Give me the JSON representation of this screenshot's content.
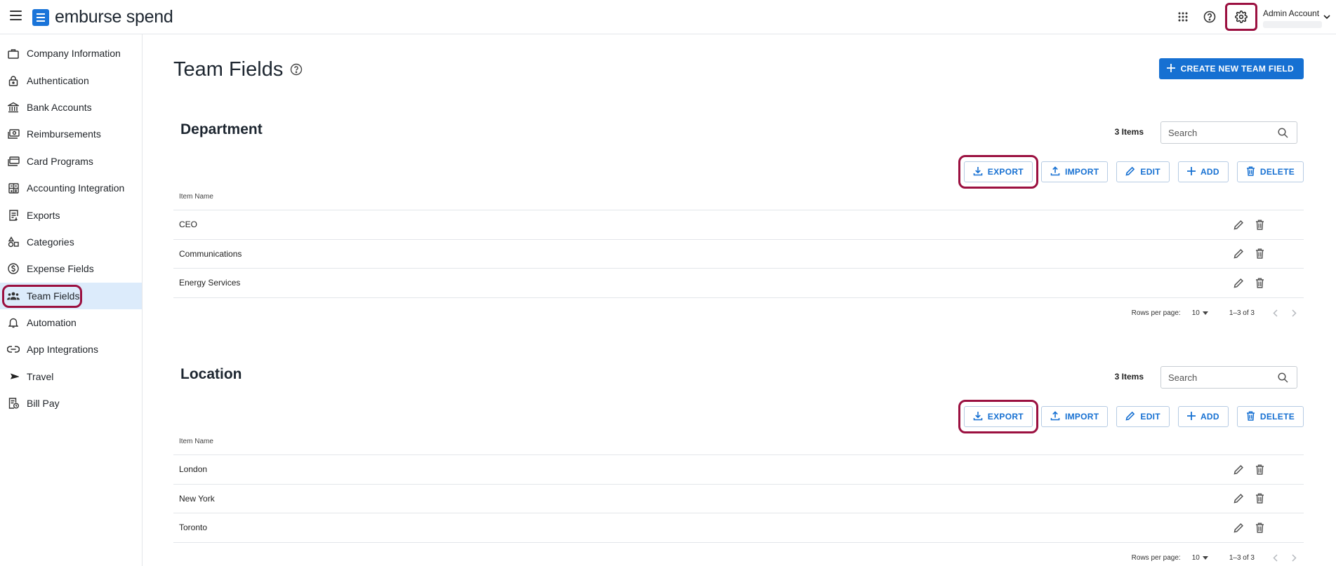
{
  "header": {
    "brand": "emburse spend",
    "account_name": "Admin Account"
  },
  "sidebar": {
    "items": [
      {
        "label": "Company Information",
        "icon": "briefcase-icon"
      },
      {
        "label": "Authentication",
        "icon": "lock-icon"
      },
      {
        "label": "Bank Accounts",
        "icon": "bank-icon"
      },
      {
        "label": "Reimbursements",
        "icon": "money-icon"
      },
      {
        "label": "Card Programs",
        "icon": "card-icon"
      },
      {
        "label": "Accounting Integration",
        "icon": "calculator-icon"
      },
      {
        "label": "Exports",
        "icon": "export-doc-icon"
      },
      {
        "label": "Categories",
        "icon": "shapes-icon"
      },
      {
        "label": "Expense Fields",
        "icon": "dollar-circle-icon"
      },
      {
        "label": "Team Fields",
        "icon": "team-icon",
        "active": true
      },
      {
        "label": "Automation",
        "icon": "bell-icon"
      },
      {
        "label": "App Integrations",
        "icon": "link-icon"
      },
      {
        "label": "Travel",
        "icon": "plane-icon"
      },
      {
        "label": "Bill Pay",
        "icon": "bill-icon"
      }
    ]
  },
  "main": {
    "title": "Team Fields",
    "create_button": "CREATE NEW TEAM FIELD",
    "sections": [
      {
        "title": "Department",
        "items_count": "3 Items",
        "search_placeholder": "Search",
        "actions": {
          "export": "EXPORT",
          "import": "IMPORT",
          "edit": "EDIT",
          "add": "ADD",
          "delete": "DELETE"
        },
        "column_header": "Item Name",
        "rows": [
          "CEO",
          "Communications",
          "Energy Services"
        ],
        "rows_per_page_label": "Rows per page:",
        "rows_per_page": "10",
        "range": "1–3 of 3"
      },
      {
        "title": "Location",
        "items_count": "3 Items",
        "search_placeholder": "Search",
        "actions": {
          "export": "EXPORT",
          "import": "IMPORT",
          "edit": "EDIT",
          "add": "ADD",
          "delete": "DELETE"
        },
        "column_header": "Item Name",
        "rows": [
          "London",
          "New York",
          "Toronto"
        ],
        "rows_per_page_label": "Rows per page:",
        "rows_per_page": "10",
        "range": "1–3 of 3"
      }
    ]
  },
  "colors": {
    "accent": "#1670d2",
    "active_nav_bg": "#dcebfb",
    "highlight": "#9b1040"
  }
}
